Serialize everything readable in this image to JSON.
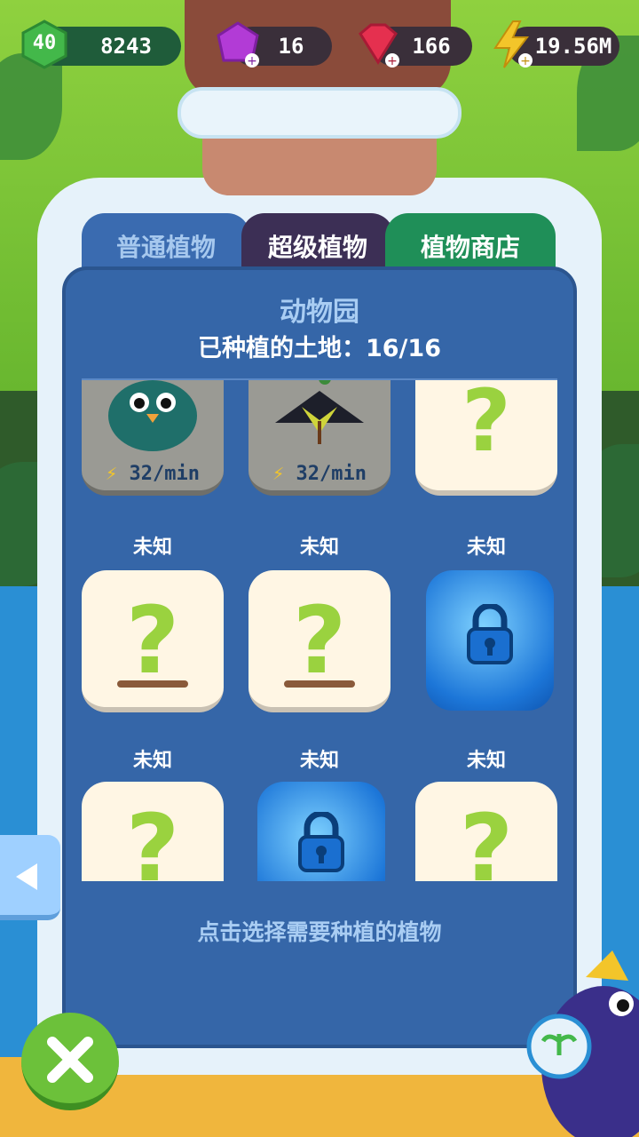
{
  "colors": {
    "accent_green": "#1f8f58",
    "panel_blue": "#3566a8",
    "super_tab": "#3c2f55"
  },
  "top_bar": {
    "level": "40",
    "xp": "8243",
    "purple_gems": "16",
    "red_gems": "166",
    "energy": "19.56M"
  },
  "tabs": [
    {
      "label": "普通植物",
      "icon": "none"
    },
    {
      "label": "超级植物"
    },
    {
      "label": "植物商店"
    }
  ],
  "zone": {
    "title": "动物园",
    "planted_label": "已种植的土地：16/16"
  },
  "grid": {
    "row1": [
      {
        "type": "plant",
        "icon": "green-penguin-plant-icon",
        "rate": "32/min"
      },
      {
        "type": "plant",
        "icon": "dark-flower-plant-icon",
        "rate": "32/min"
      },
      {
        "type": "unknown",
        "icon": "question-mark-sprout-icon"
      }
    ],
    "row2_caption": [
      "未知",
      "未知",
      "未知"
    ],
    "row2": [
      {
        "type": "unknown",
        "icon": "question-mark-sprout-icon"
      },
      {
        "type": "unknown",
        "icon": "question-mark-sprout-icon"
      },
      {
        "type": "locked",
        "icon": "ice-lock-icon"
      }
    ],
    "row3_caption": [
      "未知",
      "未知",
      "未知"
    ],
    "row3": [
      {
        "type": "unknown",
        "icon": "question-mark-sprout-icon"
      },
      {
        "type": "locked",
        "icon": "ice-lock-icon"
      },
      {
        "type": "unknown",
        "icon": "question-mark-sprout-icon"
      }
    ]
  },
  "hint": "点击选择需要种植的植物"
}
